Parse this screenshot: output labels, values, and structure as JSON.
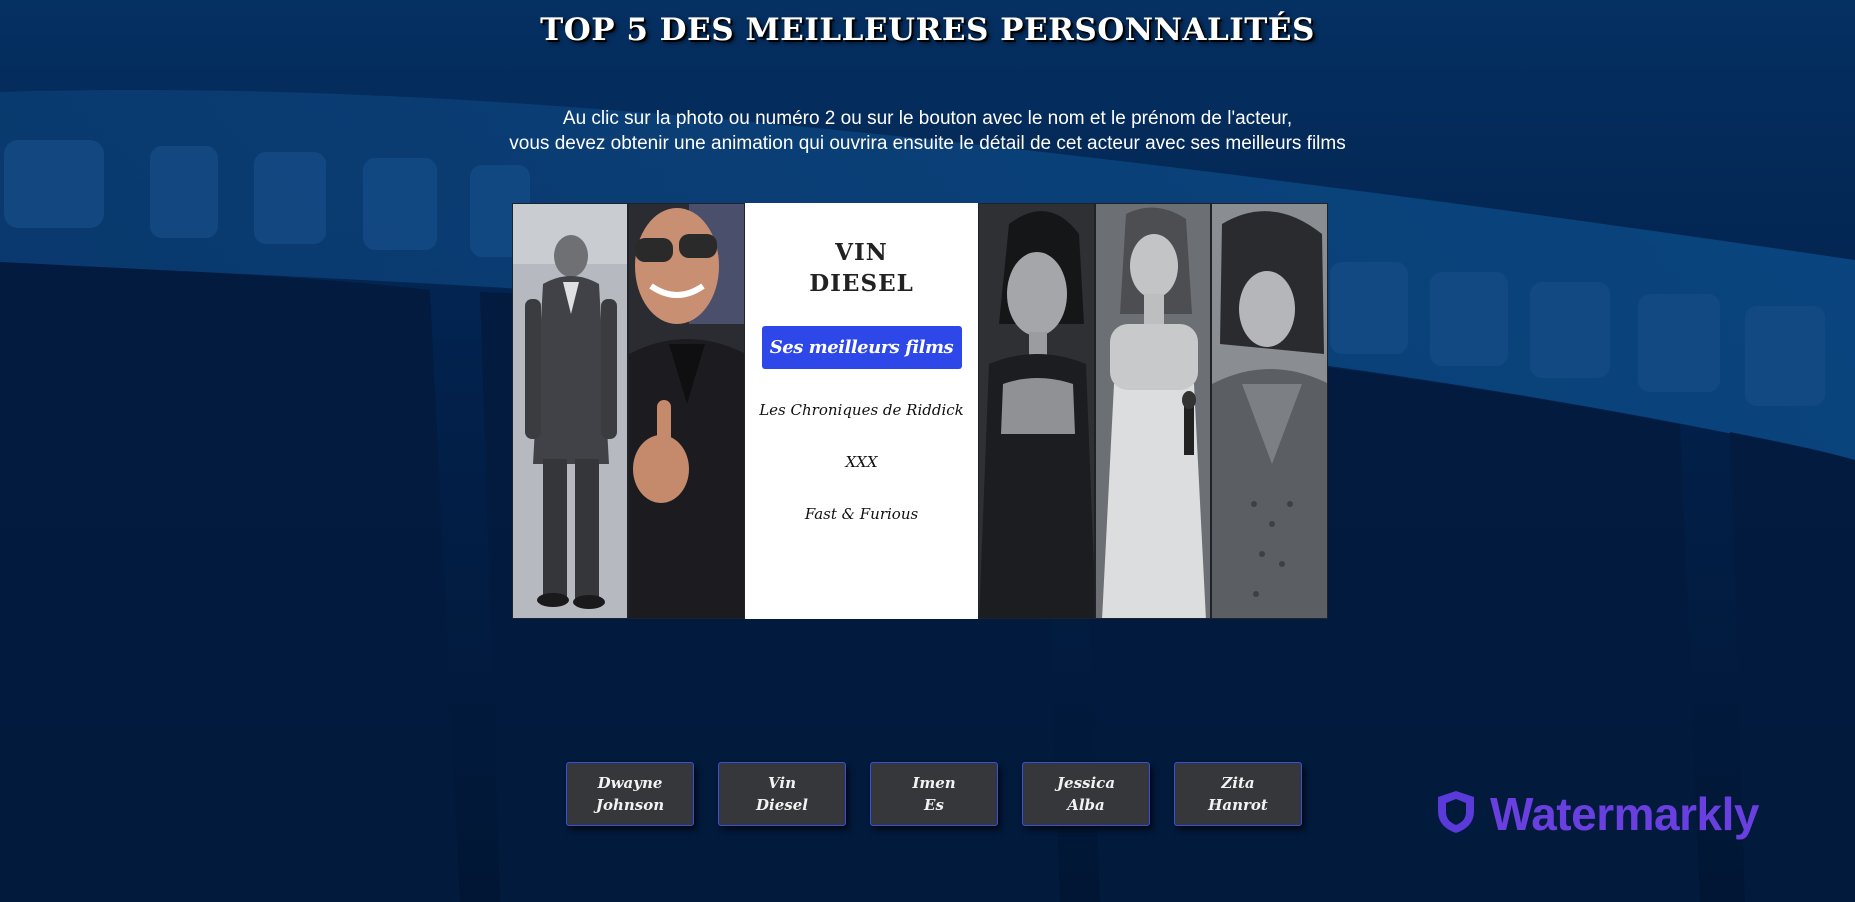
{
  "page_title": "TOP 5 DES MEILLEURES PERSONNALITÉS",
  "intro": {
    "line1": "Au clic sur la photo ou numéro 2 ou sur le bouton avec le nom et le prénom de l'acteur,",
    "line2": "vous devez obtenir une animation qui ouvrira ensuite le détail de cet acteur avec ses meilleurs films"
  },
  "detail": {
    "first_name": "VIN",
    "last_name": "DIESEL",
    "button_label": "Ses meilleurs films",
    "films": [
      "Les Chroniques de Riddick",
      "XXX",
      "Fast & Furious"
    ]
  },
  "gallery": [
    {
      "name": "Dwayne Johnson",
      "tone": "grayscale"
    },
    {
      "name": "Vin Diesel",
      "tone": "color"
    },
    {
      "name": "Imen Es",
      "tone": "grayscale"
    },
    {
      "name": "Jessica Alba",
      "tone": "grayscale"
    },
    {
      "name": "Zita Hanrot",
      "tone": "grayscale"
    }
  ],
  "name_buttons": [
    {
      "line1": "Dwayne",
      "line2": "Johnson"
    },
    {
      "line1": "Vin",
      "line2": "Diesel"
    },
    {
      "line1": "Imen",
      "line2": "Es"
    },
    {
      "line1": "Jessica",
      "line2": "Alba"
    },
    {
      "line1": "Zita",
      "line2": "Hanrot"
    }
  ],
  "watermark": {
    "text": "Watermarkly",
    "icon": "shield-icon"
  },
  "colors": {
    "background": "#021a3a",
    "accent_button": "#2d47e8",
    "name_button_bg": "#36373a",
    "name_button_border": "#3a4fd8",
    "watermark": "#6a3fe0"
  }
}
